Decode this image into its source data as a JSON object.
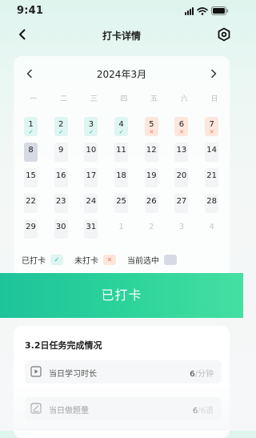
{
  "status_bar": {
    "time": "9:41",
    "icons": [
      "signal-icon",
      "wifi-icon",
      "battery-icon"
    ]
  },
  "nav": {
    "title": "打卡详情",
    "back_icon": "chevron-left-icon",
    "settings_icon": "settings-hexagon-icon"
  },
  "calendar": {
    "month_label": "2024年3月",
    "weekdays": [
      "一",
      "二",
      "三",
      "四",
      "五",
      "六",
      "日"
    ],
    "days": [
      {
        "label": "1",
        "state": "checked"
      },
      {
        "label": "2",
        "state": "checked"
      },
      {
        "label": "3",
        "state": "checked"
      },
      {
        "label": "4",
        "state": "checked"
      },
      {
        "label": "5",
        "state": "missed"
      },
      {
        "label": "6",
        "state": "missed"
      },
      {
        "label": "7",
        "state": "missed"
      },
      {
        "label": "8",
        "state": "selected"
      },
      {
        "label": "9",
        "state": "neutral"
      },
      {
        "label": "10",
        "state": "neutral"
      },
      {
        "label": "11",
        "state": "neutral"
      },
      {
        "label": "12",
        "state": "neutral"
      },
      {
        "label": "13",
        "state": "neutral"
      },
      {
        "label": "14",
        "state": "neutral"
      },
      {
        "label": "15",
        "state": "neutral"
      },
      {
        "label": "16",
        "state": "neutral"
      },
      {
        "label": "17",
        "state": "neutral"
      },
      {
        "label": "18",
        "state": "neutral"
      },
      {
        "label": "19",
        "state": "neutral"
      },
      {
        "label": "20",
        "state": "neutral"
      },
      {
        "label": "21",
        "state": "neutral"
      },
      {
        "label": "22",
        "state": "neutral"
      },
      {
        "label": "23",
        "state": "neutral"
      },
      {
        "label": "24",
        "state": "neutral"
      },
      {
        "label": "25",
        "state": "neutral"
      },
      {
        "label": "26",
        "state": "neutral"
      },
      {
        "label": "27",
        "state": "neutral"
      },
      {
        "label": "28",
        "state": "neutral"
      },
      {
        "label": "29",
        "state": "neutral"
      },
      {
        "label": "30",
        "state": "neutral"
      },
      {
        "label": "31",
        "state": "neutral"
      },
      {
        "label": "1",
        "state": "other"
      },
      {
        "label": "2",
        "state": "other"
      },
      {
        "label": "3",
        "state": "other"
      },
      {
        "label": "4",
        "state": "other"
      }
    ],
    "legend": {
      "checked": "已打卡",
      "missed": "未打卡",
      "selected": "当前选中"
    }
  },
  "checkin_button": {
    "label": "已打卡"
  },
  "tasks": {
    "title": "3.2日任务完成情况",
    "items": [
      {
        "icon": "play-square-icon",
        "label": "当日学习时长",
        "value": "6",
        "unit": "/分钟"
      },
      {
        "icon": "edit-document-icon",
        "label": "当日做题量",
        "value": "6",
        "unit": "/6道"
      }
    ]
  },
  "colors": {
    "accent": "#1ec39a",
    "checked_bg": "#def5f1",
    "missed_bg": "#fde6dc",
    "selected_bg": "#d7dae4",
    "check_mark": "#1bb79b",
    "miss_mark": "#ef7b5c"
  }
}
